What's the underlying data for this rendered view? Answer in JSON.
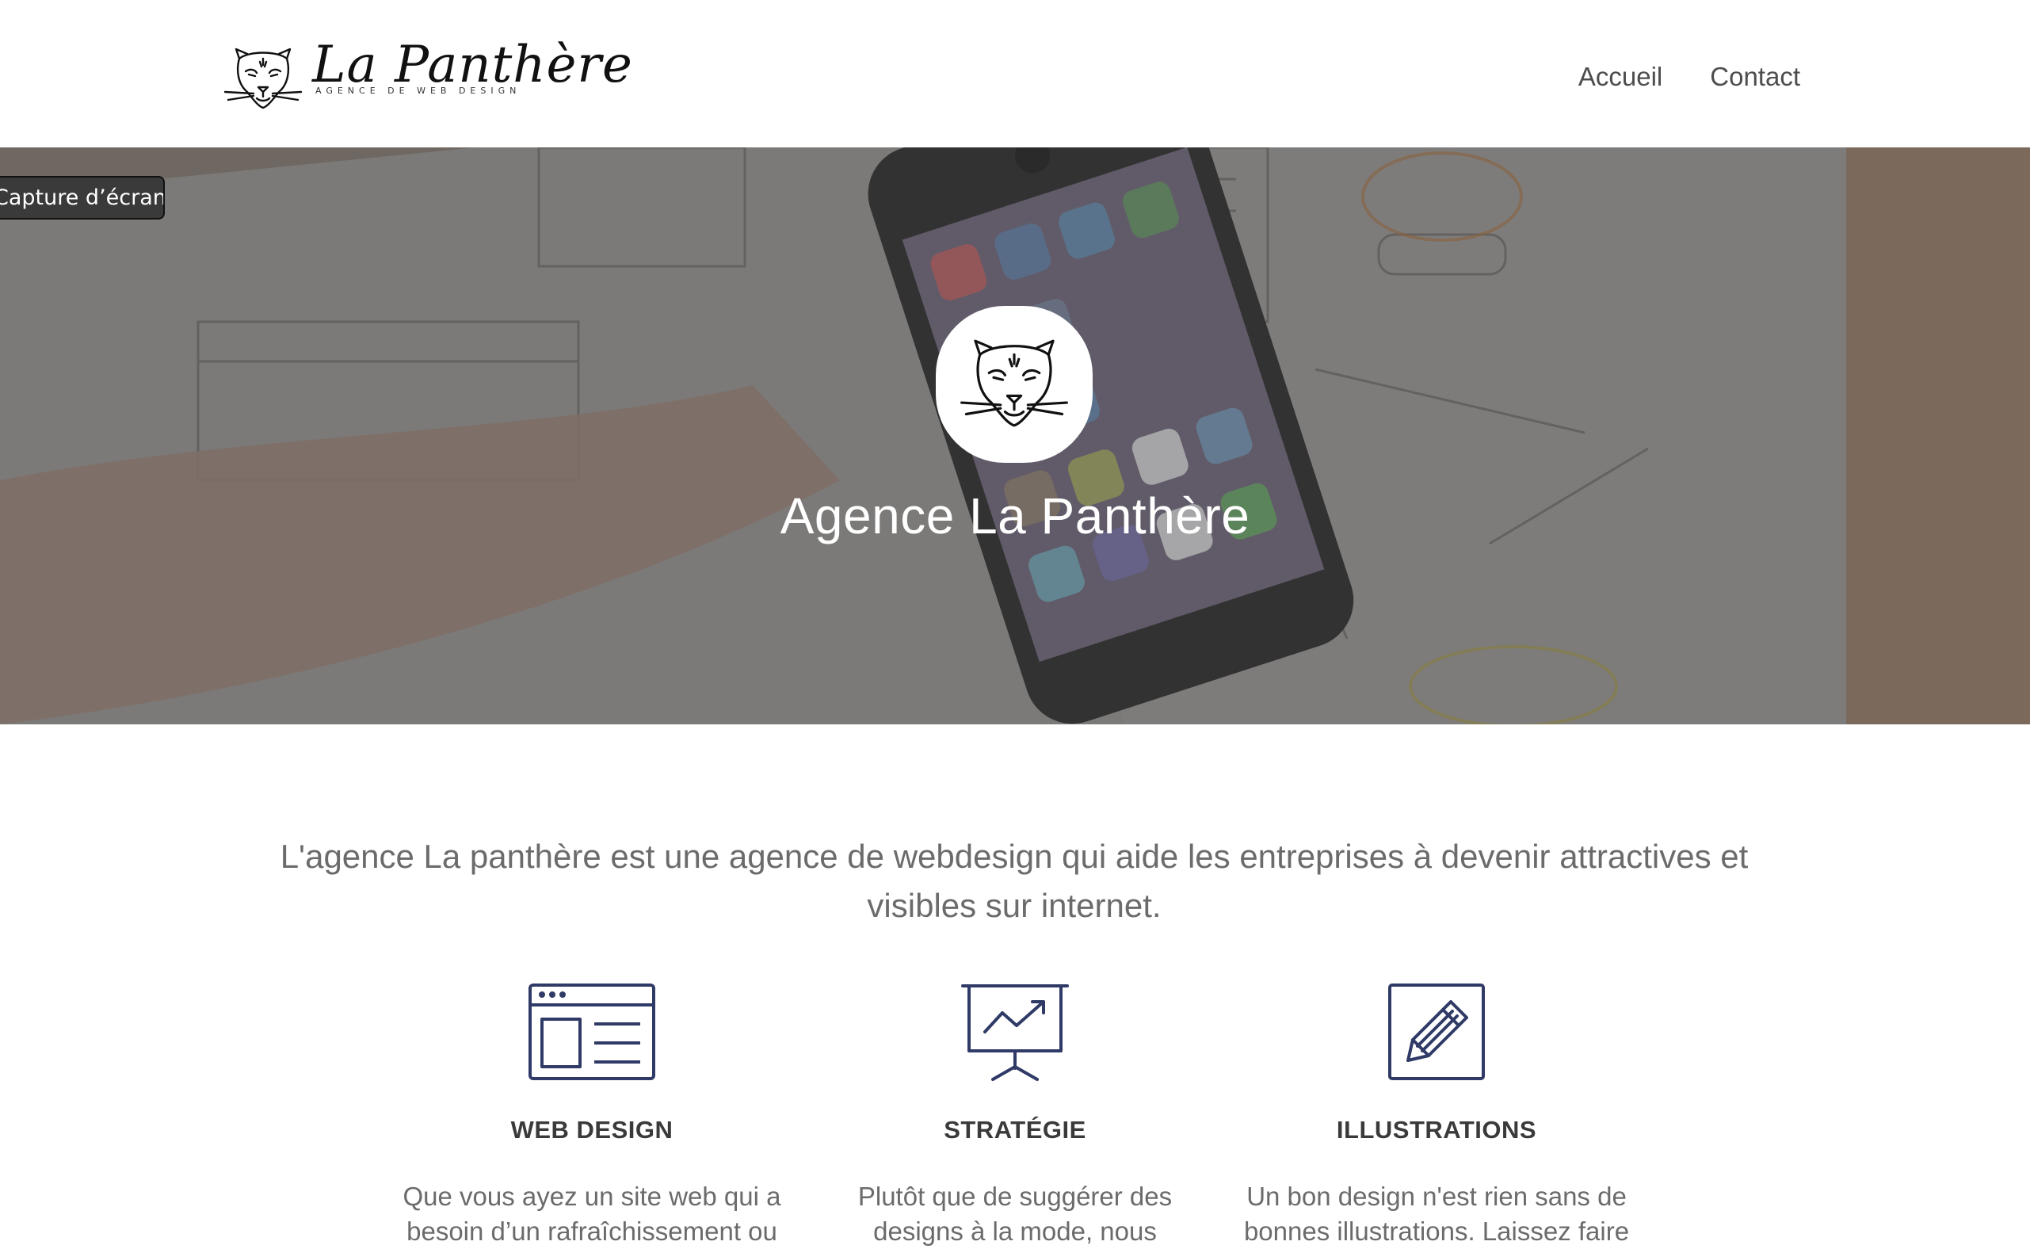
{
  "header": {
    "brand_name": "La Panthère",
    "brand_tagline": "AGENCE DE WEB DESIGN",
    "nav": [
      {
        "label": "Accueil"
      },
      {
        "label": "Contact"
      }
    ]
  },
  "overlay": {
    "capture_label": "Capture d’écran"
  },
  "hero": {
    "title": "Agence La Panthère"
  },
  "intro": {
    "text": "L'agence La panthère est une agence de webdesign qui aide les entreprises à devenir attractives et visibles sur internet."
  },
  "services": [
    {
      "icon": "browser-layout-icon",
      "title": "WEB DESIGN",
      "text": "Que vous ayez un site web qui a besoin d’un rafraîchissement ou"
    },
    {
      "icon": "presentation-chart-icon",
      "title": "STRATÉGIE",
      "text": "Plutôt que de suggérer des designs à la mode, nous"
    },
    {
      "icon": "pencil-square-icon",
      "title": "ILLUSTRATIONS",
      "text": "Un bon design n'est rien sans de bonnes illustrations. Laissez faire"
    }
  ],
  "colors": {
    "icon_stroke": "#2f3a66",
    "hero_overlay": "#6e6b68",
    "text": "#6b6b6b"
  }
}
